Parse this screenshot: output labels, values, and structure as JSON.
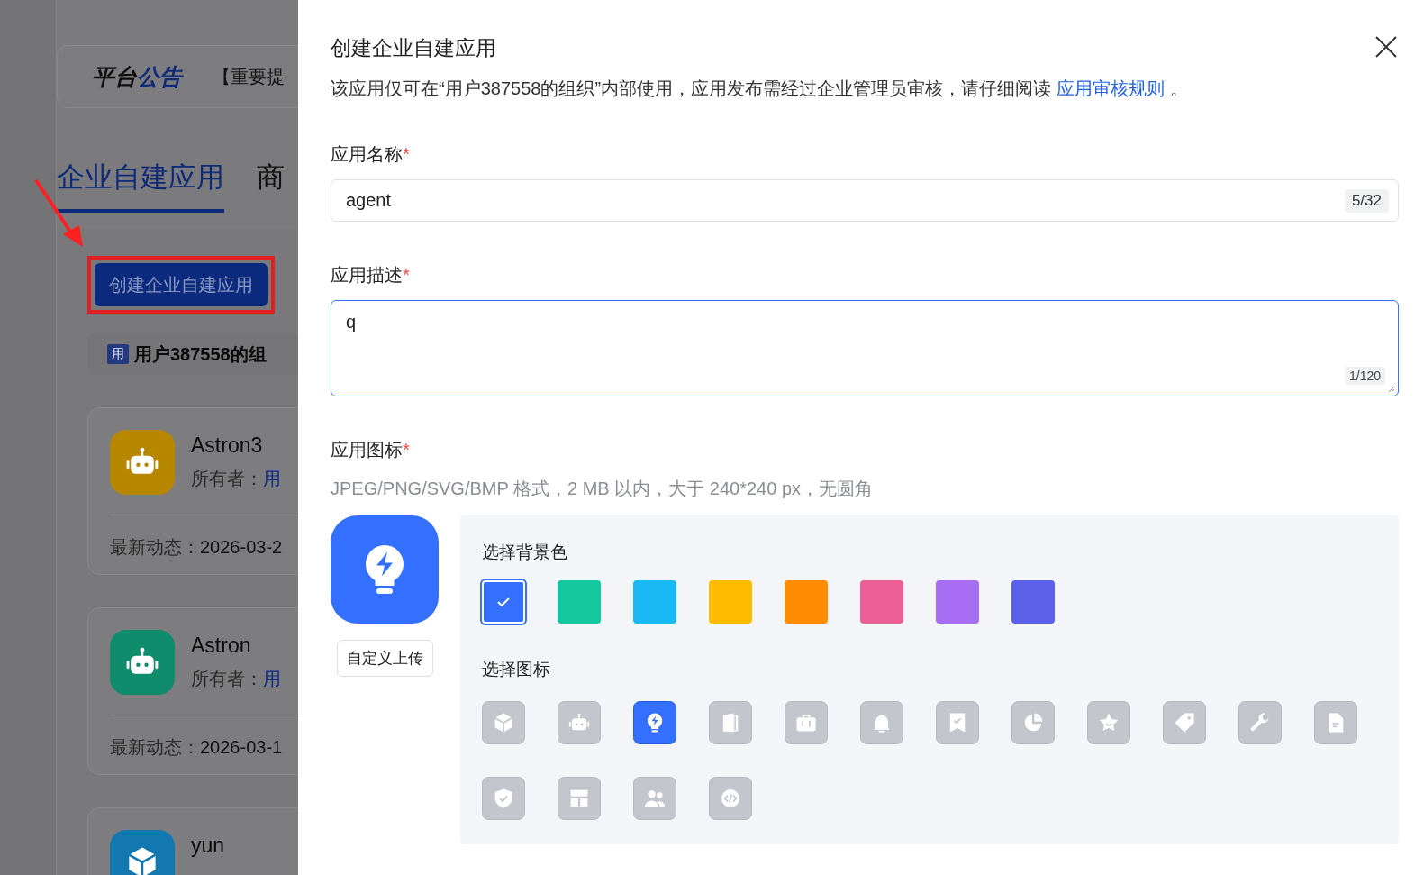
{
  "background_page": {
    "notice": {
      "title_parts": [
        "平台",
        "公告"
      ],
      "text": "【重要提"
    },
    "tabs": [
      {
        "label": "企业自建应用",
        "selected": true
      },
      {
        "label": "商",
        "selected": false
      }
    ],
    "create_button": "创建企业自建应用",
    "organization": {
      "badge": "用",
      "name": "用户387558的组"
    },
    "apps": [
      {
        "name": "Astron3",
        "kind": "robot",
        "color": "#b88700",
        "owner_label": "所有者：",
        "owner": "用",
        "activity_label": "最新动态：",
        "activity": "2026-03-2"
      },
      {
        "name": "Astron",
        "kind": "robot",
        "color": "#0e8c6c",
        "owner_label": "所有者：",
        "owner": "用",
        "activity_label": "最新动态：",
        "activity": "2026-03-1"
      },
      {
        "name": "yun",
        "kind": "cube",
        "color": "#1478b0"
      }
    ]
  },
  "drawer": {
    "title": "创建企业自建应用",
    "notice": "该应用仅可在“用户387558的组织”内部使用，应用发布需经过企业管理员审核，请仔细阅读",
    "notice_link": "应用审核规则",
    "notice_end": "。",
    "fields": [
      {
        "kind": "input",
        "label": "应用名称",
        "required_mark": "*",
        "value": "agent",
        "counter": "5/32",
        "focused": false
      },
      {
        "kind": "textarea",
        "label": "应用描述",
        "required_mark": "*",
        "value": "q",
        "counter": "1/120",
        "focused": true
      }
    ],
    "icon_section": {
      "label": "应用图标",
      "required_mark": "*",
      "hint": "JPEG/PNG/SVG/BMP 格式，2 MB 以内，大于 240*240 px，无圆角",
      "upload_button": "自定义上传",
      "colors_heading": "选择背景色",
      "colors": [
        {
          "color": "#3370ff",
          "selected": true
        },
        {
          "color": "#14c9a0",
          "selected": false
        },
        {
          "color": "#1ab8f5",
          "selected": false
        },
        {
          "color": "#ffbb00",
          "selected": false
        },
        {
          "color": "#ff8c00",
          "selected": false
        },
        {
          "color": "#ec5f96",
          "selected": false
        },
        {
          "color": "#a76ef5",
          "selected": false
        },
        {
          "color": "#5a60ea",
          "selected": false
        }
      ],
      "icons_heading": "选择图标",
      "icons": [
        {
          "kind": "cube",
          "selected": false
        },
        {
          "kind": "robot",
          "selected": false
        },
        {
          "kind": "bulb",
          "selected": true
        },
        {
          "kind": "door",
          "selected": false
        },
        {
          "kind": "briefcase",
          "selected": false
        },
        {
          "kind": "bell",
          "selected": false
        },
        {
          "kind": "bookmark",
          "selected": false
        },
        {
          "kind": "pie",
          "selected": false
        },
        {
          "kind": "star",
          "selected": false
        },
        {
          "kind": "tag",
          "selected": false
        },
        {
          "kind": "wrench",
          "selected": false
        },
        {
          "kind": "document",
          "selected": false
        },
        {
          "kind": "shield",
          "selected": false
        },
        {
          "kind": "layout",
          "selected": false
        },
        {
          "kind": "users",
          "selected": false
        },
        {
          "kind": "code",
          "selected": false
        }
      ]
    }
  }
}
